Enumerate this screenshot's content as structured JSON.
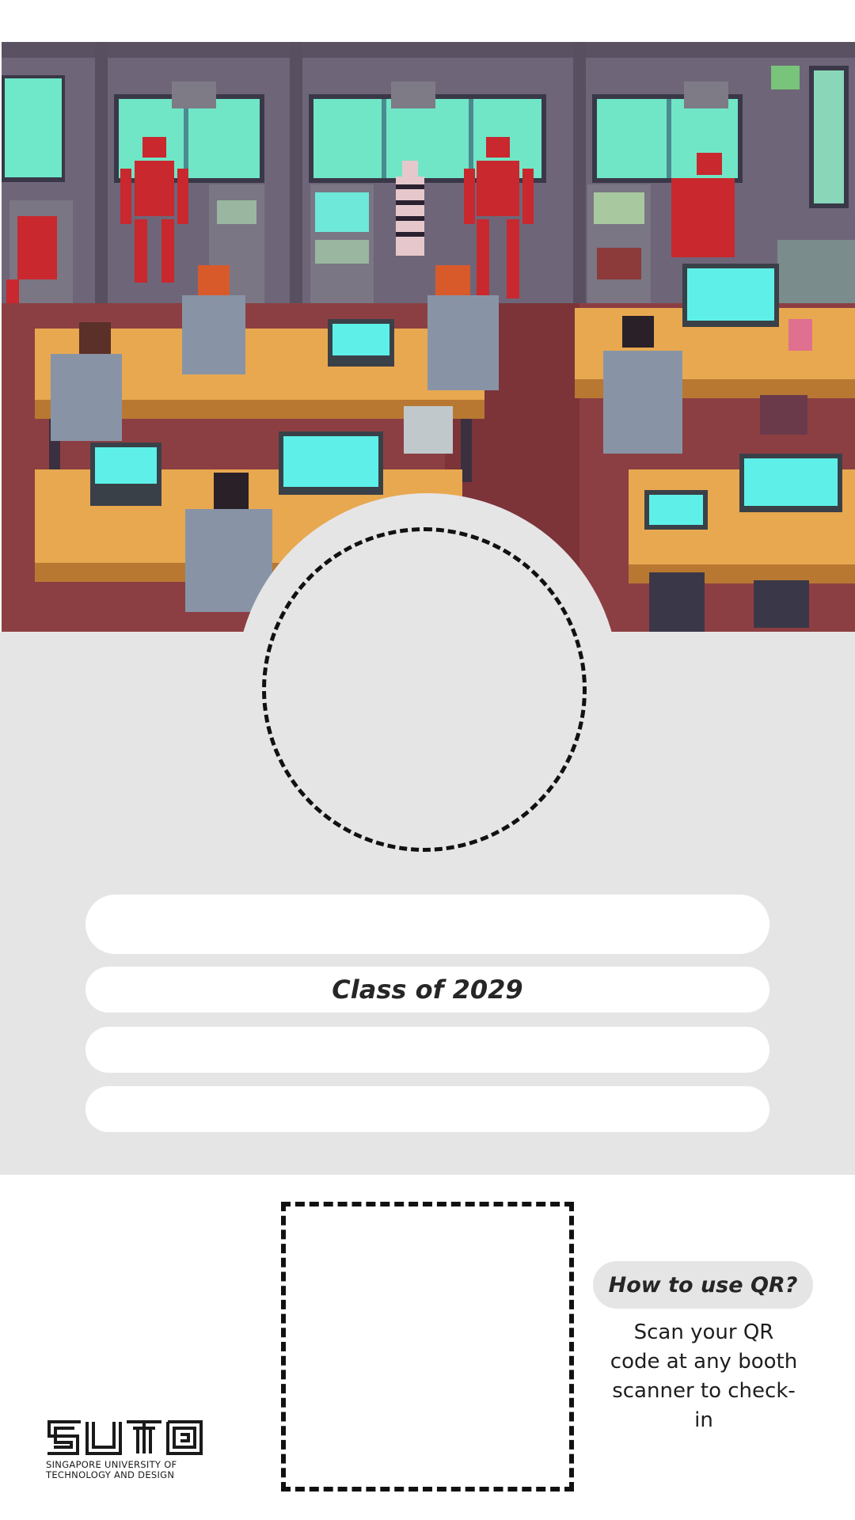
{
  "card": {
    "name": "",
    "class_label": "Class of 2029",
    "field_3": "",
    "field_4": ""
  },
  "qr_help": {
    "title": "How to use QR?",
    "description": "Scan your QR code at any booth scanner to check-in"
  },
  "logo": {
    "org_line1": "SINGAPORE UNIVERSITY OF",
    "org_line2": "TECHNOLOGY AND DESIGN"
  },
  "colors": {
    "panel": "#e6e5e6",
    "dash": "#111111",
    "pill": "#ffffff",
    "screen_cyan": "#5ef0e8",
    "robot_red": "#c8282e",
    "desk": "#e8a850"
  }
}
